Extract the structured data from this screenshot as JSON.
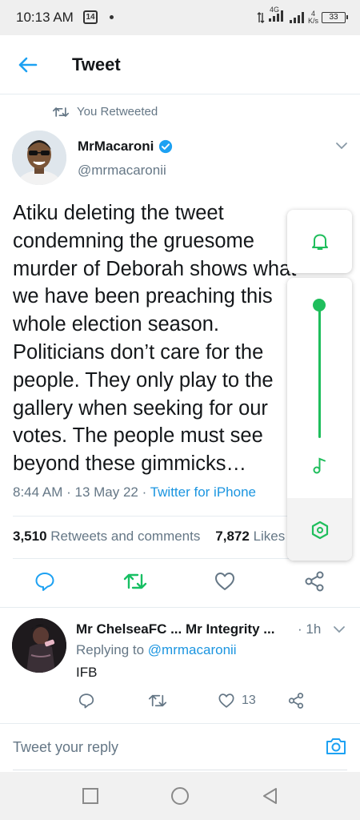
{
  "status_bar": {
    "time": "10:13 AM",
    "app_badge": "14",
    "network_type": "4G",
    "speed": "4",
    "speed_unit": "K/s",
    "battery": "33"
  },
  "header": {
    "title": "Tweet"
  },
  "retweet_notice": "You Retweeted",
  "tweet": {
    "author_name": "MrMacaroni",
    "author_handle": "@mrmacaronii",
    "text": "Atiku deleting the tweet\ncondemning the gruesome\nmurder of Deborah shows what\nwe have been preaching this\nwhole election season.\nPoliticians don’t care for the\npeople. They only play to the\ngallery when seeking for our\nvotes. The people must see\nbeyond these gimmicks…",
    "time": "8:44 AM",
    "date": "13 May 22",
    "source": "Twitter for iPhone",
    "retweets_count": "3,510",
    "retweets_label": "Retweets and comments",
    "likes_count": "7,872",
    "likes_label": "Likes"
  },
  "reply": {
    "author_name": "Mr ChelseaFC ... Mr Integrity ...",
    "time": "1h",
    "replying_label": "Replying to",
    "replying_handle": "@mrmacaronii",
    "text": "IFB",
    "like_count": "13"
  },
  "reply_box": {
    "placeholder": "Tweet your reply"
  },
  "colors": {
    "twitter_blue": "#1da1f2",
    "retweet_green": "#17bf63",
    "panel_green": "#1fbe5c",
    "secondary_text": "#657786"
  },
  "volume_panel": {
    "level_percent": 100
  }
}
